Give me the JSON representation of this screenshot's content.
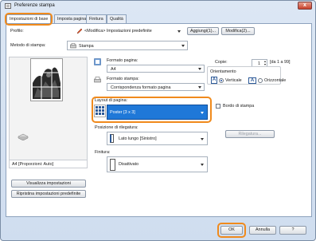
{
  "window": {
    "title": "Preferenze stampa",
    "close_label": "x"
  },
  "tabs": [
    {
      "label": "Impostazioni di base"
    },
    {
      "label": "Imposta pagina"
    },
    {
      "label": "Finitura"
    },
    {
      "label": "Qualità"
    }
  ],
  "profile": {
    "label": "Profilo:",
    "value": "<Modifica> Impostazioni predefinite",
    "add_label": "Aggiungi(1)...",
    "edit_label": "Modifica(2)..."
  },
  "output_method": {
    "label": "Metodo di stampa:",
    "value": "Stampa"
  },
  "page_size": {
    "label": "Formato pagina:",
    "value": "A4"
  },
  "output_size": {
    "label": "Formato stampa:",
    "value": "Corrispondenza formato pagina"
  },
  "copies": {
    "label": "Copie:",
    "value": "1",
    "range": "[da 1 a 99]"
  },
  "orientation": {
    "label": "Orientamento",
    "portrait": "Verticale",
    "landscape": "Orizzontale"
  },
  "page_layout": {
    "label": "Layout di pagina:",
    "value": "Poster [3 x 3]"
  },
  "page_border": {
    "label": "Bordo di stampa"
  },
  "binding": {
    "label": "Posizione di rilegatura:",
    "value": "Lato lungo [Sinistro]",
    "button_label": "Rilegatura..."
  },
  "finishing": {
    "label": "Finitura:",
    "value": "Disattivato"
  },
  "preview": {
    "footer": "A4 [Proporzioni: Auto]"
  },
  "left_buttons": {
    "view_settings": "Visualizza impostazioni",
    "restore_defaults": "Ripristina impostazioni predefinite"
  },
  "footer": {
    "ok": "OK",
    "cancel": "Annulla",
    "help": "?"
  },
  "colors": {
    "accent": "#f08a1c",
    "selection": "#1f78d8"
  }
}
